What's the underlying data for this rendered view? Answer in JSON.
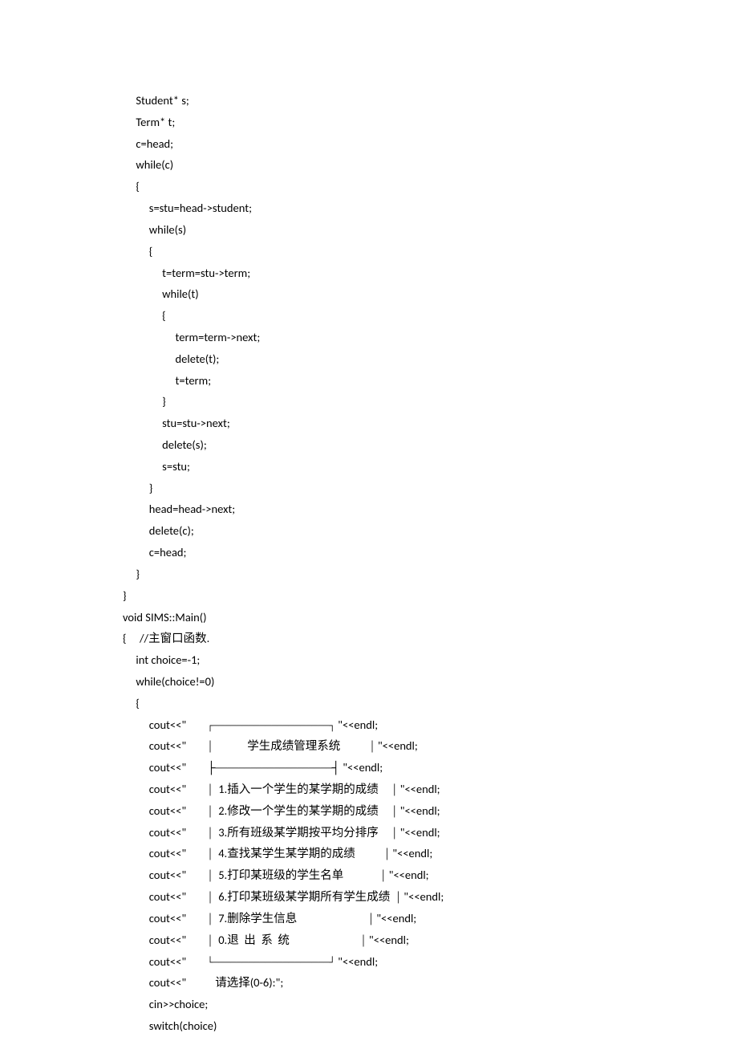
{
  "lines": [
    "     Student* s;",
    "     Term* t;",
    "     c=head;",
    "     while(c)",
    "     {",
    "          s=stu=head->student;",
    "          while(s)",
    "          {",
    "               t=term=stu->term;",
    "               while(t)",
    "               {",
    "                    term=term->next;",
    "                    delete(t);",
    "                    t=term;",
    "               }",
    "               stu=stu->next;",
    "               delete(s);",
    "               s=stu;",
    "          }",
    "          head=head->next;",
    "          delete(c);",
    "          c=head;",
    "     }",
    "}",
    "void SIMS::Main()",
    "{     //主窗口函数.",
    "     int choice=-1;",
    "     while(choice!=0)",
    "     {",
    "          cout<<\"        ┌────────────────────┐ \"<<endl;",
    "          cout<<\"        │             学生成绩管理系统           │ \"<<endl;",
    "          cout<<\"        ├────────────────────┤ \"<<endl;",
    "          cout<<\"        │  1.插入一个学生的某学期的成绩     │ \"<<endl;",
    "          cout<<\"        │  2.修改一个学生的某学期的成绩     │ \"<<endl;",
    "          cout<<\"        │  3.所有班级某学期按平均分排序     │ \"<<endl;",
    "          cout<<\"        │  4.查找某学生某学期的成绩           │ \"<<endl;",
    "          cout<<\"        │  5.打印某班级的学生名单              │ \"<<endl;",
    "          cout<<\"        │  6.打印某班级某学期所有学生成绩  │ \"<<endl;",
    "          cout<<\"        │  7.删除学生信息                           │ \"<<endl;",
    "          cout<<\"        │  0.退  出  系  统                           │ \"<<endl;",
    "          cout<<\"        └────────────────────┘ \"<<endl;",
    "          cout<<\"           请选择(0-6):\";",
    "          cin>>choice;",
    "          switch(choice)"
  ]
}
